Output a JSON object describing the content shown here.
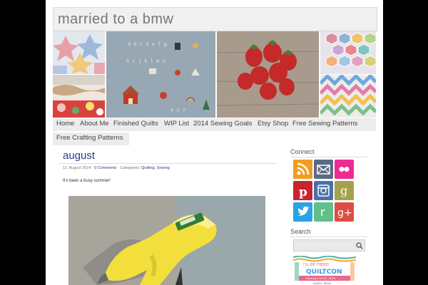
{
  "site": {
    "title": "married to a bmw"
  },
  "banner": {
    "images": [
      "quilt-star-blocks",
      "quilt-red-floral",
      "cross-stitch-sampler",
      "strawberries",
      "hexagon-quilt",
      "zigzag-quilt"
    ]
  },
  "nav": {
    "items": [
      "Home",
      "About Me",
      "Finished Quilts",
      "WIP List",
      "2014 Sewing Goals",
      "Etsy Shop",
      "Free Sewing Patterns",
      "Free Crafting Patterns"
    ]
  },
  "post": {
    "title": "august",
    "date": "11. August 2014",
    "sep1": " · ",
    "comments": "0 Comments",
    "categories_label": " · Categories: ",
    "cat1": "Quilting",
    "cat_sep": ", ",
    "cat2": "Sewing",
    "excerpt": "It's been a busy summer!",
    "image": "yellow-glue-gun-photo"
  },
  "sidebar": {
    "connect_title": "Connect",
    "social": [
      {
        "name": "rss-icon",
        "color": "#f39b23"
      },
      {
        "name": "email-icon",
        "color": "#5a6b85"
      },
      {
        "name": "flickr-icon",
        "color": "#ee2b93"
      },
      {
        "name": "pinterest-icon",
        "color": "#c9232d"
      },
      {
        "name": "instagram-icon",
        "color": "#4a72a9"
      },
      {
        "name": "goodreads-icon",
        "color": "#a4a14c"
      },
      {
        "name": "twitter-icon",
        "color": "#2aa2e3"
      },
      {
        "name": "reader-icon",
        "color": "#62bf8a"
      },
      {
        "name": "google-plus-icon",
        "color": "#dc4e41"
      }
    ],
    "search_title": "Search",
    "search_placeholder": "",
    "badge": {
      "line1": "I'LL BE THERE!",
      "line2": "QUILTCON",
      "line3": "February 19-22, 2015",
      "line4": "Austin, Texas"
    }
  },
  "colors": {
    "link": "#2c3d86",
    "background": "#000000"
  }
}
